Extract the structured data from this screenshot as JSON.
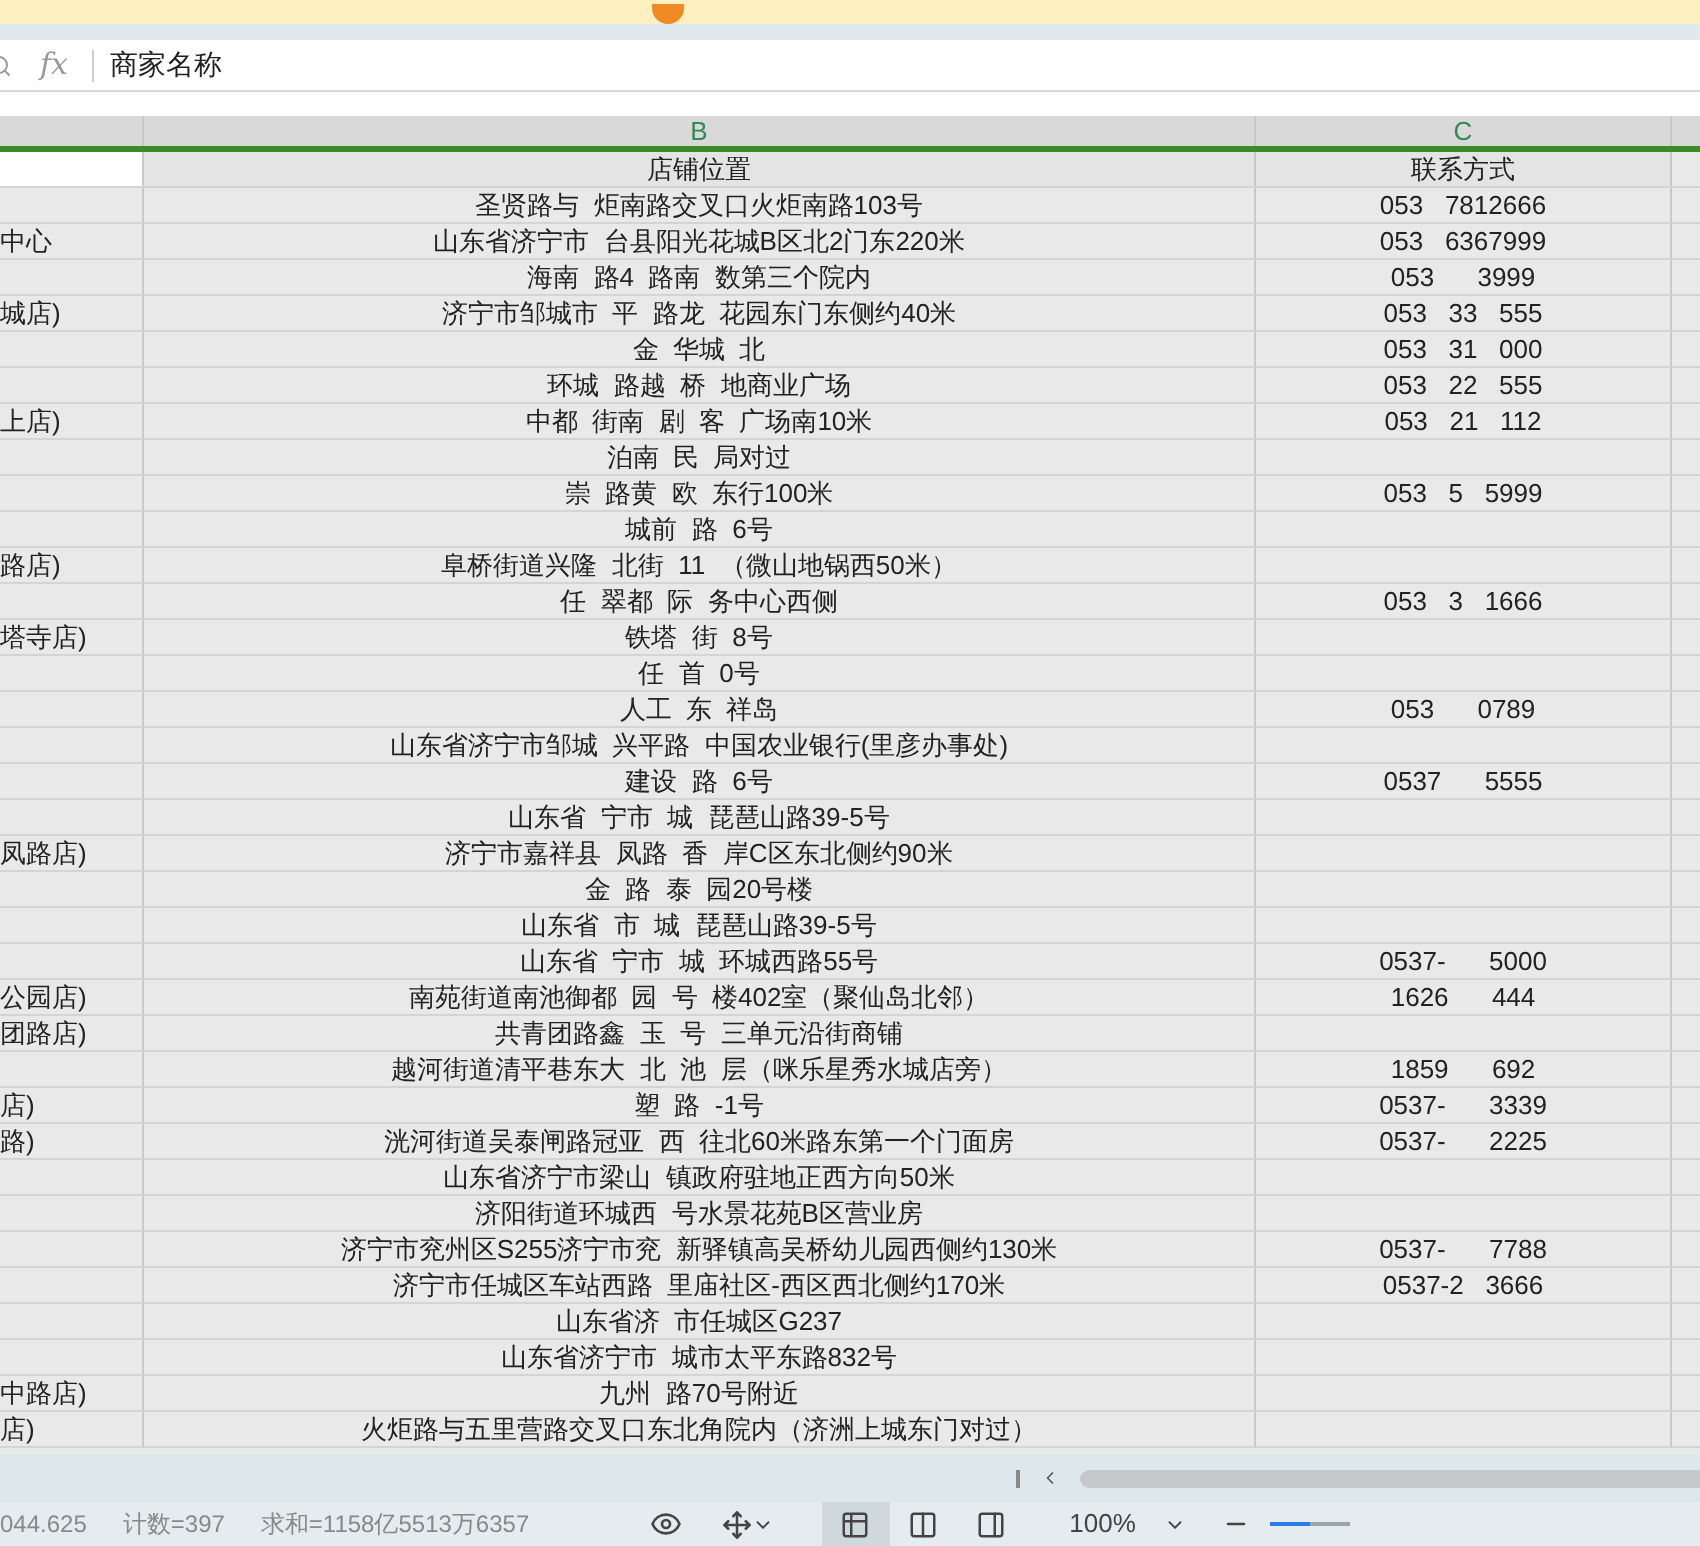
{
  "formula_bar": {
    "fx": "fx",
    "value": "商家名称"
  },
  "column_headers": [
    {
      "letter": "B",
      "selected": true
    },
    {
      "letter": "C",
      "selected": true
    }
  ],
  "header_row": {
    "address": "店铺位置",
    "contact": "联系方式"
  },
  "rows": [
    {
      "column_1": "",
      "address": "圣贤路与  炬南路交叉口火炬南路103号",
      "contact": "053   7812666"
    },
    {
      "column_1": "中心",
      "address": "山东省济宁市  台县阳光花城B区北2门东220米",
      "contact": "053   6367999"
    },
    {
      "column_1": "",
      "address": "海南  路4  路南  数第三个院内",
      "contact": "053      3999"
    },
    {
      "column_1": "城店)",
      "address": "济宁市邹城市  平  路龙  花园东门东侧约40米",
      "contact": "053   33   555"
    },
    {
      "column_1": "",
      "address": "金  华城  北",
      "contact": "053   31   000"
    },
    {
      "column_1": "",
      "address": "环城  路越  桥  地商业广场",
      "contact": "053   22   555"
    },
    {
      "column_1": "上店)",
      "address": "中都  街南  剧  客  广场南10米",
      "contact": "053   21   112"
    },
    {
      "column_1": "",
      "address": "泊南  民  局对过",
      "contact": ""
    },
    {
      "column_1": "",
      "address": "崇  路黄  欧  东行100米",
      "contact": "053   5   5999"
    },
    {
      "column_1": "",
      "address": "城前  路  6号",
      "contact": ""
    },
    {
      "column_1": "路店)",
      "address": "阜桥街道兴隆  北街  11  （微山地锅西50米）",
      "contact": ""
    },
    {
      "column_1": "",
      "address": "任  翠都  际  务中心西侧",
      "contact": "053   3   1666"
    },
    {
      "column_1": "塔寺店)",
      "address": "铁塔  街  8号",
      "contact": ""
    },
    {
      "column_1": "",
      "address": "任  首  0号",
      "contact": ""
    },
    {
      "column_1": "",
      "address": "人工  东  祥岛",
      "contact": "053      0789"
    },
    {
      "column_1": "",
      "address": "山东省济宁市邹城  兴平路  中国农业银行(里彦办事处)",
      "contact": ""
    },
    {
      "column_1": "",
      "address": "建设  路  6号",
      "contact": "0537      5555"
    },
    {
      "column_1": "",
      "address": "山东省  宁市  城  琵琶山路39-5号",
      "contact": ""
    },
    {
      "column_1": "凤路店)",
      "address": "济宁市嘉祥县  凤路  香  岸C区东北侧约90米",
      "contact": ""
    },
    {
      "column_1": "",
      "address": "金  路  泰  园20号楼",
      "contact": ""
    },
    {
      "column_1": "",
      "address": "山东省  市  城  琵琶山路39-5号",
      "contact": ""
    },
    {
      "column_1": "",
      "address": "山东省  宁市  城  环城西路55号",
      "contact": "0537-      5000"
    },
    {
      "column_1": "公园店)",
      "address": "南苑街道南池御都  园  号  楼402室（聚仙岛北邻）",
      "contact": "1626      444"
    },
    {
      "column_1": "团路店)",
      "address": "共青团路鑫  玉  号  三单元沿街商铺",
      "contact": ""
    },
    {
      "column_1": "",
      "address": "越河街道清平巷东大  北  池  层（咪乐星秀水城店旁）",
      "contact": "1859      692"
    },
    {
      "column_1": "店)",
      "address": "塑  路  -1号",
      "contact": "0537-      3339"
    },
    {
      "column_1": "路)",
      "address": "洸河街道吴泰闸路冠亚  西  往北60米路东第一个门面房",
      "contact": "0537-      2225"
    },
    {
      "column_1": "",
      "address": "山东省济宁市梁山  镇政府驻地正西方向50米",
      "contact": ""
    },
    {
      "column_1": "",
      "address": "济阳街道环城西  号水景花苑B区营业房",
      "contact": ""
    },
    {
      "column_1": "",
      "address": "济宁市兖州区S255济宁市兖  新驿镇高吴桥幼儿园西侧约130米",
      "contact": "0537-      7788"
    },
    {
      "column_1": "",
      "address": "济宁市任城区车站西路  里庙社区-西区西北侧约170米",
      "contact": "0537-2   3666"
    },
    {
      "column_1": "",
      "address": "山东省济  市任城区G237",
      "contact": ""
    },
    {
      "column_1": "",
      "address": "山东省济宁市  城市太平东路832号",
      "contact": ""
    },
    {
      "column_1": "中路店)",
      "address": "九州  路70号附近",
      "contact": ""
    },
    {
      "column_1": "店)",
      "address": "火炬路与五里营路交叉口东北角院内（济洲上城东门对过）",
      "contact": ""
    }
  ],
  "status_bar": {
    "average": "044.625",
    "count": "计数=397",
    "sum": "求和=1158亿5513万6357",
    "zoom": "100%",
    "zoom_slider": {
      "level": 0.5
    },
    "views": [
      {
        "kind": "normal",
        "selected": true
      },
      {
        "kind": "page",
        "selected": false
      },
      {
        "kind": "break",
        "selected": false
      }
    ]
  }
}
